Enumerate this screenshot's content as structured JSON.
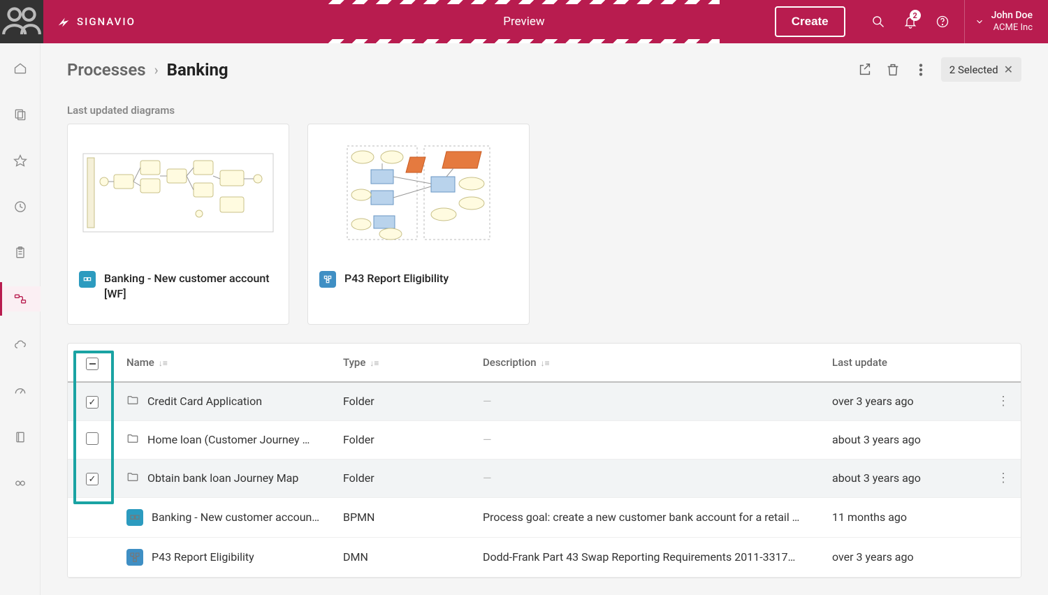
{
  "brand": {
    "name": "SIGNAVIO"
  },
  "preview_label": "Preview",
  "create_label": "Create",
  "notifications_count": "2",
  "user": {
    "name": "John Doe",
    "org": "ACME Inc"
  },
  "breadcrumb": {
    "root": "Processes",
    "current": "Banking"
  },
  "selection_chip": "2 Selected",
  "section_title": "Last updated diagrams",
  "cards": [
    {
      "title": "Banking - New customer account [WF]",
      "type": "bpmn"
    },
    {
      "title": "P43 Report Eligibility",
      "type": "dmn"
    }
  ],
  "table": {
    "headers": {
      "name": "Name",
      "type": "Type",
      "description": "Description",
      "last_update": "Last update"
    },
    "rows": [
      {
        "selected": true,
        "icon": "folder",
        "name": "Credit Card Application",
        "type": "Folder",
        "description": "—",
        "last_update": "over 3 years ago",
        "show_more": true
      },
      {
        "selected": false,
        "icon": "folder",
        "name": "Home loan (Customer Journey …",
        "type": "Folder",
        "description": "—",
        "last_update": "about 3 years ago",
        "show_more": false
      },
      {
        "selected": true,
        "icon": "folder",
        "name": "Obtain bank loan Journey Map",
        "type": "Folder",
        "description": "—",
        "last_update": "about 3 years ago",
        "show_more": true
      },
      {
        "selected": false,
        "icon": "bpmn",
        "name": "Banking - New customer accoun…",
        "type": "BPMN",
        "description": "Process goal: create a new customer bank account for a retail …",
        "last_update": "11 months ago",
        "show_more": false
      },
      {
        "selected": false,
        "icon": "dmn",
        "name": "P43 Report Eligibility",
        "type": "DMN",
        "description": "Dodd-Frank Part 43 Swap Reporting Requirements 2011-3317…",
        "last_update": "over 3 years ago",
        "show_more": false
      }
    ]
  }
}
